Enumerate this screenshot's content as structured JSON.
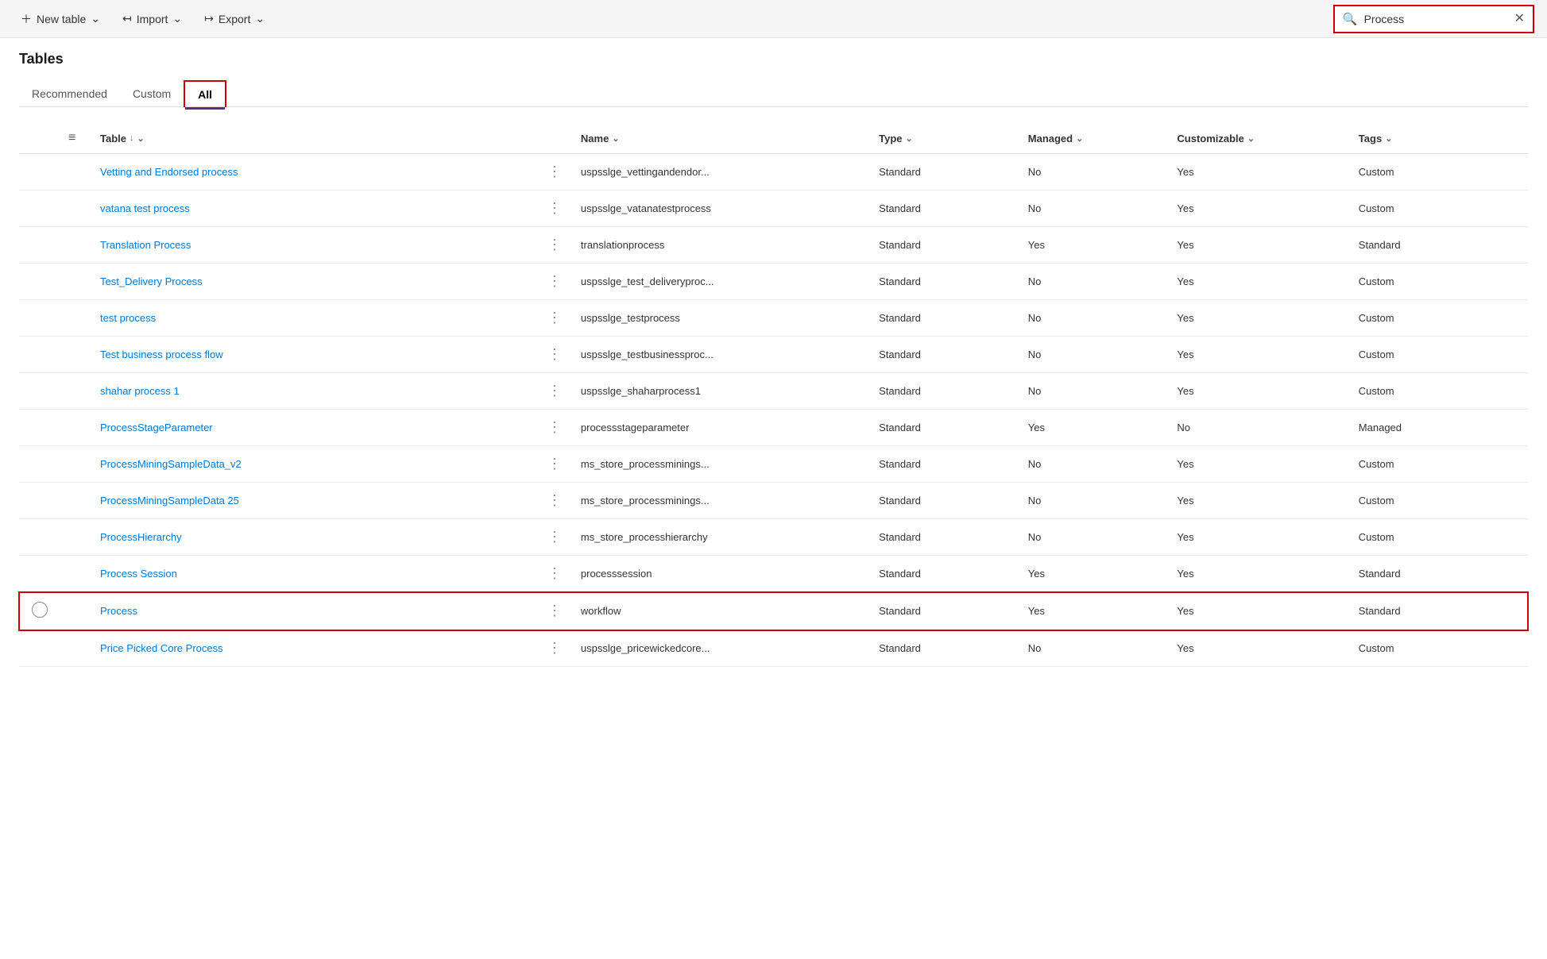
{
  "toolbar": {
    "new_table_label": "New table",
    "import_label": "Import",
    "export_label": "Export",
    "search_placeholder": "Process",
    "search_value": "Process"
  },
  "page": {
    "title": "Tables",
    "tabs": [
      {
        "id": "recommended",
        "label": "Recommended",
        "active": false
      },
      {
        "id": "custom",
        "label": "Custom",
        "active": false
      },
      {
        "id": "all",
        "label": "All",
        "active": true
      }
    ]
  },
  "table": {
    "columns": [
      {
        "id": "table",
        "label": "Table",
        "sortable": true,
        "chevron": true
      },
      {
        "id": "name",
        "label": "Name",
        "sortable": false,
        "chevron": true
      },
      {
        "id": "type",
        "label": "Type",
        "sortable": false,
        "chevron": true
      },
      {
        "id": "managed",
        "label": "Managed",
        "sortable": false,
        "chevron": true
      },
      {
        "id": "customizable",
        "label": "Customizable",
        "sortable": false,
        "chevron": true
      },
      {
        "id": "tags",
        "label": "Tags",
        "sortable": false,
        "chevron": true
      }
    ],
    "rows": [
      {
        "id": 1,
        "table": "Vetting and Endorsed process",
        "name": "uspsslge_vettingandendor...",
        "type": "Standard",
        "managed": "No",
        "customizable": "Yes",
        "tags": "Custom",
        "selected": false
      },
      {
        "id": 2,
        "table": "vatana test process",
        "name": "uspsslge_vatanatestprocess",
        "type": "Standard",
        "managed": "No",
        "customizable": "Yes",
        "tags": "Custom",
        "selected": false
      },
      {
        "id": 3,
        "table": "Translation Process",
        "name": "translationprocess",
        "type": "Standard",
        "managed": "Yes",
        "customizable": "Yes",
        "tags": "Standard",
        "selected": false
      },
      {
        "id": 4,
        "table": "Test_Delivery Process",
        "name": "uspsslge_test_deliveryproc...",
        "type": "Standard",
        "managed": "No",
        "customizable": "Yes",
        "tags": "Custom",
        "selected": false
      },
      {
        "id": 5,
        "table": "test process",
        "name": "uspsslge_testprocess",
        "type": "Standard",
        "managed": "No",
        "customizable": "Yes",
        "tags": "Custom",
        "selected": false
      },
      {
        "id": 6,
        "table": "Test business process flow",
        "name": "uspsslge_testbusinessproc...",
        "type": "Standard",
        "managed": "No",
        "customizable": "Yes",
        "tags": "Custom",
        "selected": false
      },
      {
        "id": 7,
        "table": "shahar process 1",
        "name": "uspsslge_shaharprocess1",
        "type": "Standard",
        "managed": "No",
        "customizable": "Yes",
        "tags": "Custom",
        "selected": false
      },
      {
        "id": 8,
        "table": "ProcessStageParameter",
        "name": "processstageparameter",
        "type": "Standard",
        "managed": "Yes",
        "customizable": "No",
        "tags": "Managed",
        "selected": false
      },
      {
        "id": 9,
        "table": "ProcessMiningSampleData_v2",
        "name": "ms_store_processminings...",
        "type": "Standard",
        "managed": "No",
        "customizable": "Yes",
        "tags": "Custom",
        "selected": false
      },
      {
        "id": 10,
        "table": "ProcessMiningSampleData 25",
        "name": "ms_store_processminings...",
        "type": "Standard",
        "managed": "No",
        "customizable": "Yes",
        "tags": "Custom",
        "selected": false
      },
      {
        "id": 11,
        "table": "ProcessHierarchy",
        "name": "ms_store_processhierarchy",
        "type": "Standard",
        "managed": "No",
        "customizable": "Yes",
        "tags": "Custom",
        "selected": false
      },
      {
        "id": 12,
        "table": "Process Session",
        "name": "processsession",
        "type": "Standard",
        "managed": "Yes",
        "customizable": "Yes",
        "tags": "Standard",
        "selected": false
      },
      {
        "id": 13,
        "table": "Process",
        "name": "workflow",
        "type": "Standard",
        "managed": "Yes",
        "customizable": "Yes",
        "tags": "Standard",
        "selected": true
      },
      {
        "id": 14,
        "table": "Price Picked Core Process",
        "name": "uspsslge_pricewickedcore...",
        "type": "Standard",
        "managed": "No",
        "customizable": "Yes",
        "tags": "Custom",
        "selected": false
      }
    ]
  }
}
